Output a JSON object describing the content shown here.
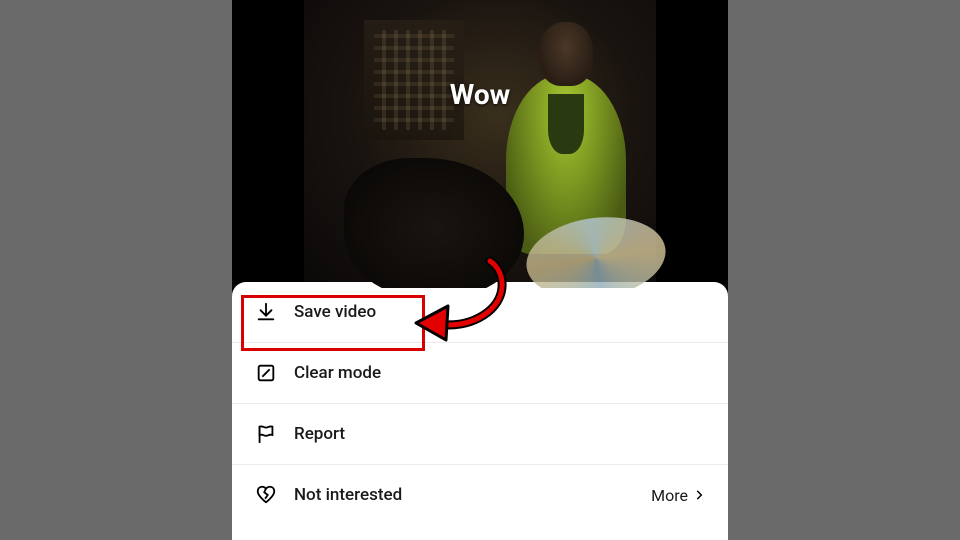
{
  "video": {
    "caption": "Wow"
  },
  "menu": {
    "save": "Save video",
    "clear": "Clear mode",
    "report": "Report",
    "not_interested": "Not interested",
    "more": "More"
  }
}
